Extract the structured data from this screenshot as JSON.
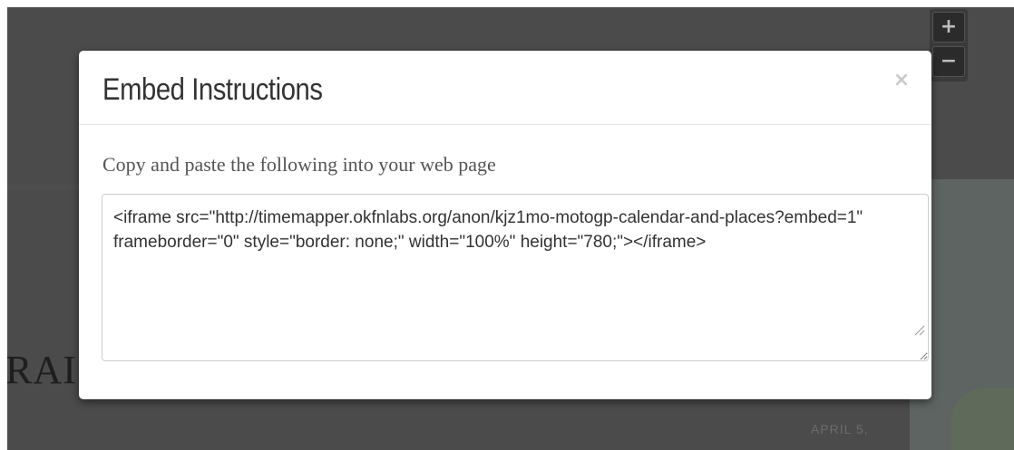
{
  "background": {
    "title_fragment": "RAI",
    "date_label": "APRIL 5,",
    "zoom_in_label": "+",
    "zoom_out_label": "−"
  },
  "modal": {
    "title": "Embed Instructions",
    "close_label": "×",
    "instructions": "Copy and paste the following into your web page",
    "embed_code": "<iframe src=\"http://timemapper.okfnlabs.org/anon/kjz1mo-motogp-calendar-and-places?embed=1\" frameborder=\"0\" style=\"border: none;\" width=\"100%\" height=\"780;\"></iframe>"
  },
  "colors": {
    "overlay": "#4b4b4b",
    "modal_bg": "#ffffff",
    "title_text": "#333333",
    "body_text": "#555555",
    "close_icon": "#c8c8c8",
    "border": "#cccccc"
  }
}
